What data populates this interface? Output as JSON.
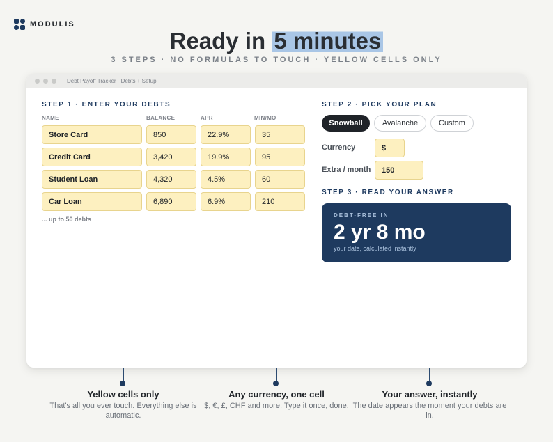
{
  "brand": {
    "name": "MODULIS",
    "colors": {
      "navy": "#1e3a5f",
      "yellow_cell": "#fdf0c0",
      "highlight": "#a9c6e6"
    }
  },
  "hero": {
    "headline_prefix": "Ready in",
    "headline_highlight": "5 minutes",
    "subheadline": "3 STEPS · NO FORMULAS TO TOUCH · YELLOW CELLS ONLY"
  },
  "window": {
    "title": "Debt Payoff Tracker · Debts + Setup",
    "step1": {
      "title": "STEP 1 · ENTER YOUR DEBTS",
      "columns": [
        "NAME",
        "BALANCE",
        "APR",
        "MIN/MO"
      ],
      "rows": [
        {
          "name": "Store Card",
          "balance": "850",
          "apr": "22.9%",
          "min": "35"
        },
        {
          "name": "Credit Card",
          "balance": "3,420",
          "apr": "19.9%",
          "min": "95"
        },
        {
          "name": "Student Loan",
          "balance": "4,320",
          "apr": "4.5%",
          "min": "60"
        },
        {
          "name": "Car Loan",
          "balance": "6,890",
          "apr": "6.9%",
          "min": "210"
        }
      ],
      "more_note": "... up to 50 debts"
    },
    "step2": {
      "title": "STEP 2 · PICK YOUR PLAN",
      "plans": [
        "Snowball",
        "Avalanche",
        "Custom"
      ],
      "selected_plan": "Snowball",
      "currency_label": "Currency",
      "currency_value": "$",
      "extra_label": "Extra / month",
      "extra_value": "150"
    },
    "step3": {
      "title": "STEP 3 · READ YOUR ANSWER",
      "answer_label": "DEBT-FREE IN",
      "answer_value": "2 yr 8 mo",
      "answer_sub": "your date, calculated instantly"
    }
  },
  "callouts": [
    {
      "title": "Yellow cells only",
      "desc": "That's all you ever touch. Everything else is automatic."
    },
    {
      "title": "Any currency, one cell",
      "desc": "$, €, £, CHF and more. Type it once, done."
    },
    {
      "title": "Your answer, instantly",
      "desc": "The date appears the moment your debts are in."
    }
  ]
}
